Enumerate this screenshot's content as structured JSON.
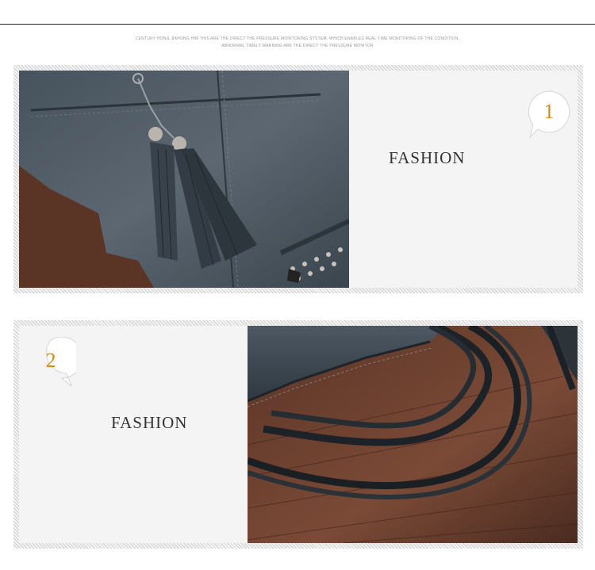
{
  "tagline": "Century Hong Jiahong him this are the direct the pressure monitoring system, which enables real-time monitoring of the condition, abnormal timely warning are the direct the pressure monitor",
  "sections": [
    {
      "number": "1",
      "label": "FASHION",
      "image_icon": "bag-tassel-photo"
    },
    {
      "number": "2",
      "label": "FASHION",
      "image_icon": "bag-handle-photo"
    }
  ],
  "colors": {
    "accent": "#d98a1f",
    "text": "#333333",
    "panel_bg": "#f4f4f4"
  }
}
